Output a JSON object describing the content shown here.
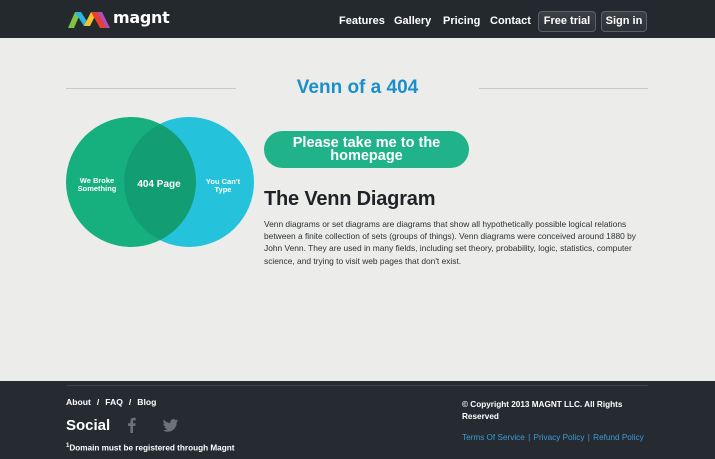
{
  "brand": {
    "name": "magnt"
  },
  "nav": {
    "features": "Features",
    "gallery": "Gallery",
    "pricing": "Pricing",
    "contact": "Contact",
    "free_trial": "Free trial",
    "sign_in": "Sign in"
  },
  "main": {
    "title": "Venn of a 404",
    "venn": {
      "left_line1": "We Broke",
      "left_line2": "Something",
      "center": "404 Page",
      "right_line1": "You Can't",
      "right_line2": "Type"
    },
    "cta_line1": "Please take me to the",
    "cta_line2": "homepage",
    "section_title": "The Venn Diagram",
    "body": "Venn diagrams or set diagrams are diagrams that show all hypothetically possible logical relations between a finite collection of sets (groups of things). Venn diagrams were conceived around 1880 by John Venn. They are used in many fields, including set theory, probability, logic, statistics, computer science, and trying to visit web pages that don't exist."
  },
  "footer": {
    "links": {
      "about": "About",
      "faq": "FAQ",
      "blog": "Blog",
      "separator": "/"
    },
    "social_title": "Social",
    "note_sup": "1",
    "note": "Domain must be registered through Magnt",
    "copyright": "© Copyright 2013 MAGNT LLC. All Rights Reserved",
    "terms": "Terms Of Service",
    "privacy": "Privacy Policy",
    "refund": "Refund Policy",
    "pipe": "|"
  },
  "colors": {
    "header_bg": "#24292e",
    "accent_blue": "#1a8fc9",
    "cta_green": "#20b38a",
    "venn_left": "#15b07e",
    "venn_right": "#19c0da",
    "footer_bg": "#262b31"
  }
}
